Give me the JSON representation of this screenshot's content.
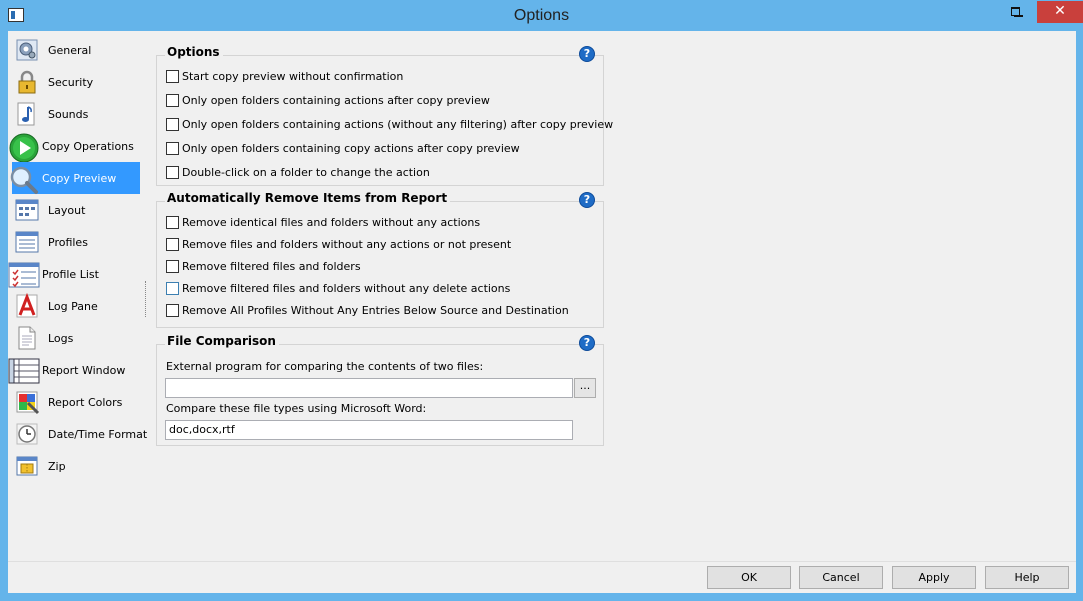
{
  "window": {
    "title": "Options"
  },
  "titlebar": {
    "minimize": "",
    "maximize": "",
    "close": "✕"
  },
  "sidebar": {
    "items": [
      {
        "label": "General",
        "icon": "gear-icon"
      },
      {
        "label": "Security",
        "icon": "lock-icon"
      },
      {
        "label": "Sounds",
        "icon": "music-note-icon"
      },
      {
        "label": "Copy Operations",
        "icon": "play-icon"
      },
      {
        "label": "Copy Preview",
        "icon": "magnifier-icon",
        "selected": true
      },
      {
        "label": "Layout",
        "icon": "layout-icon"
      },
      {
        "label": "Profiles",
        "icon": "profiles-icon"
      },
      {
        "label": "Profile List",
        "icon": "profile-list-icon"
      },
      {
        "label": "Log Pane",
        "icon": "font-a-icon"
      },
      {
        "label": "Logs",
        "icon": "document-icon"
      },
      {
        "label": "Report Window",
        "icon": "report-window-icon"
      },
      {
        "label": "Report Colors",
        "icon": "colors-icon"
      },
      {
        "label": "Date/Time Format",
        "icon": "clock-icon"
      },
      {
        "label": "Zip",
        "icon": "zip-icon"
      }
    ]
  },
  "options_group": {
    "title": "Options",
    "help": "?",
    "items": [
      {
        "label": "Start copy preview without confirmation",
        "checked": false
      },
      {
        "label": "Only open folders containing actions after copy preview",
        "checked": false
      },
      {
        "label": "Only open folders containing actions (without any filtering) after copy preview",
        "checked": false
      },
      {
        "label": "Only open folders containing copy actions after copy preview",
        "checked": false
      },
      {
        "label": "Double-click on a folder to change the action",
        "checked": false
      }
    ]
  },
  "remove_group": {
    "title": "Automatically Remove Items from Report",
    "help": "?",
    "items": [
      {
        "label": "Remove identical files and folders without any actions",
        "checked": false
      },
      {
        "label": "Remove files and folders without any actions or not present",
        "checked": false
      },
      {
        "label": "Remove filtered files and folders",
        "checked": false
      },
      {
        "label": "Remove filtered files and folders without any delete actions",
        "checked": false
      },
      {
        "label": "Remove All Profiles Without Any Entries Below Source and Destination",
        "checked": false
      }
    ]
  },
  "file_group": {
    "title": "File Comparison",
    "help": "?",
    "external_label": "External program for comparing the contents of two files:",
    "external_value": "",
    "browse_label": "...",
    "word_label": "Compare these file types using Microsoft Word:",
    "word_value": "doc,docx,rtf"
  },
  "buttons": {
    "ok": "OK",
    "cancel": "Cancel",
    "apply": "Apply",
    "help": "Help"
  },
  "colors": {
    "titlebar": "#64b4ea",
    "selection": "#3399ff",
    "close_button": "#c9403c",
    "help_icon": "#1f6cc6"
  }
}
